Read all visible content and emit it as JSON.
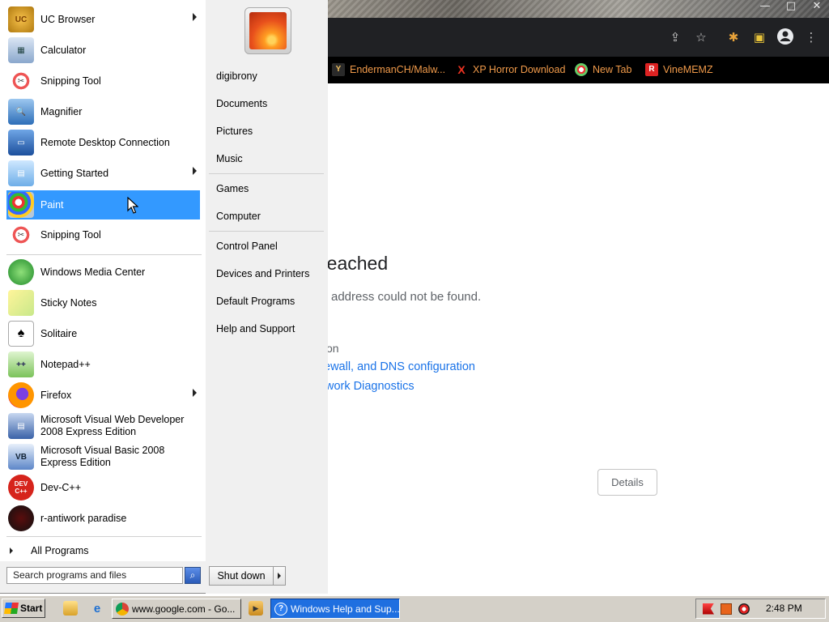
{
  "browser": {
    "window_controls": [
      "—",
      "□",
      "✕"
    ],
    "toolbar_icons": [
      "share-icon",
      "star-icon",
      "extensions-icon",
      "sidebar-icon",
      "profile-icon",
      "menu-icon"
    ],
    "bookmarks": [
      {
        "label": "EndermanCH/Malw...",
        "icon": "Y"
      },
      {
        "label": "XP Horror Download",
        "icon": "X"
      },
      {
        "label": "New Tab",
        "icon": "●"
      },
      {
        "label": "VineMEMZ",
        "icon": "R"
      }
    ],
    "error": {
      "title": "reached",
      "subtitle": "address could not be found.",
      "try_text": "on",
      "link1": "ewall, and DNS configuration",
      "link2": "work Diagnostics",
      "details_button": "Details"
    }
  },
  "start_menu": {
    "programs": [
      {
        "label": "UC Browser",
        "submenu": true
      },
      {
        "label": "Calculator"
      },
      {
        "label": "Snipping Tool"
      },
      {
        "label": "Magnifier"
      },
      {
        "label": "Remote Desktop Connection"
      },
      {
        "label": "Getting Started",
        "submenu": true
      },
      {
        "label": "Paint",
        "selected": true
      },
      {
        "label": "Snipping Tool"
      },
      {
        "label": "Windows Media Center"
      },
      {
        "label": "Sticky Notes"
      },
      {
        "label": "Solitaire"
      },
      {
        "label": "Notepad++"
      },
      {
        "label": "Firefox",
        "submenu": true
      },
      {
        "label": "Microsoft Visual Web Developer 2008 Express Edition"
      },
      {
        "label": "Microsoft Visual Basic 2008 Express Edition"
      },
      {
        "label": "Dev-C++"
      },
      {
        "label": "r-antiwork paradise"
      }
    ],
    "all_programs": "All Programs",
    "search_placeholder": "Search programs and files",
    "right_items": [
      "digibrony",
      "Documents",
      "Pictures",
      "Music",
      "Games",
      "Computer",
      "Control Panel",
      "Devices and Printers",
      "Default Programs",
      "Help and Support"
    ],
    "shutdown_label": "Shut down"
  },
  "taskbar": {
    "start_label": "Start",
    "buttons": [
      {
        "label": "www.google.com - Go...",
        "icon": "chrome-icon"
      },
      {
        "label": "Windows Help and Sup...",
        "icon": "help-icon",
        "active": true
      }
    ],
    "clock": "2:48 PM"
  },
  "colors": {
    "selection": "#3399ff",
    "bookmark_text": "#f09a4a",
    "link": "#1a73e8",
    "taskbar": "#d4d0c8",
    "active_task": "#1f6fe0"
  }
}
